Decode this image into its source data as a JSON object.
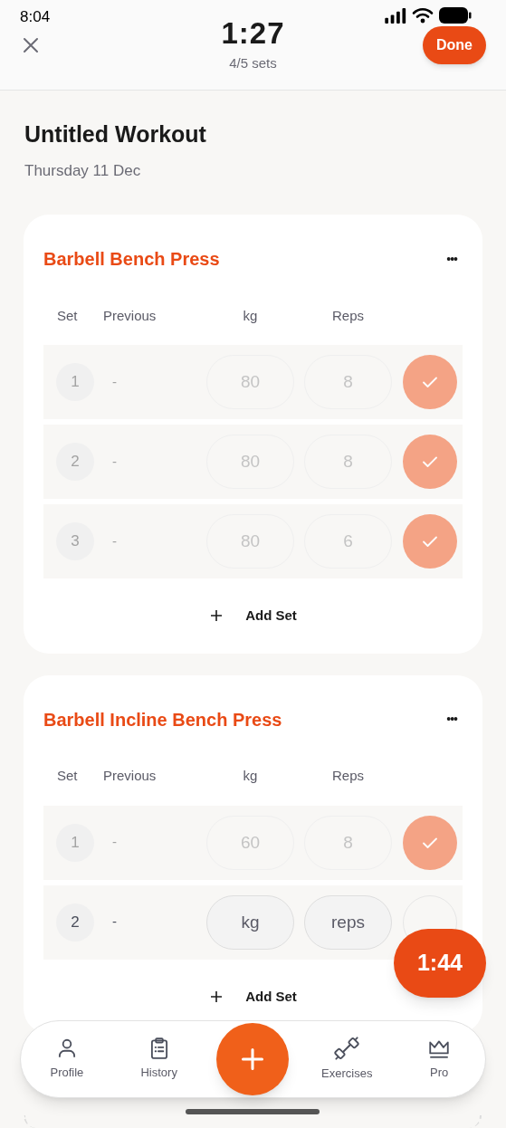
{
  "status_bar": {
    "time": "8:04"
  },
  "header": {
    "timer": "1:27",
    "progress": "4/5 sets",
    "done_button": "Done"
  },
  "workout": {
    "title": "Untitled Workout",
    "date": "Thursday 11 Dec"
  },
  "exercises": [
    {
      "name": "Barbell Bench Press",
      "more": "•••",
      "columns": [
        "Set",
        "Previous",
        "kg",
        "Reps"
      ],
      "sets": [
        {
          "number": "1",
          "previous": "-",
          "kg": "80",
          "reps": "8",
          "completed": true
        },
        {
          "number": "2",
          "previous": "-",
          "kg": "80",
          "reps": "8",
          "completed": true
        },
        {
          "number": "3",
          "previous": "-",
          "kg": "80",
          "reps": "6",
          "completed": true
        }
      ],
      "add_set": "Add Set"
    },
    {
      "name": "Barbell Incline Bench Press",
      "more": "•••",
      "columns": [
        "Set",
        "Previous",
        "kg",
        "Reps"
      ],
      "sets": [
        {
          "number": "1",
          "previous": "-",
          "kg": "60",
          "reps": "8",
          "completed": true
        },
        {
          "number": "2",
          "previous": "-",
          "kg_placeholder": "kg",
          "reps_placeholder": "reps",
          "completed": false
        }
      ],
      "add_set": "Add Set"
    }
  ],
  "rest_timer": "1:44",
  "nav": [
    {
      "label": "Profile"
    },
    {
      "label": "History"
    },
    {
      "label": "Exercises"
    },
    {
      "label": "Pro"
    }
  ]
}
